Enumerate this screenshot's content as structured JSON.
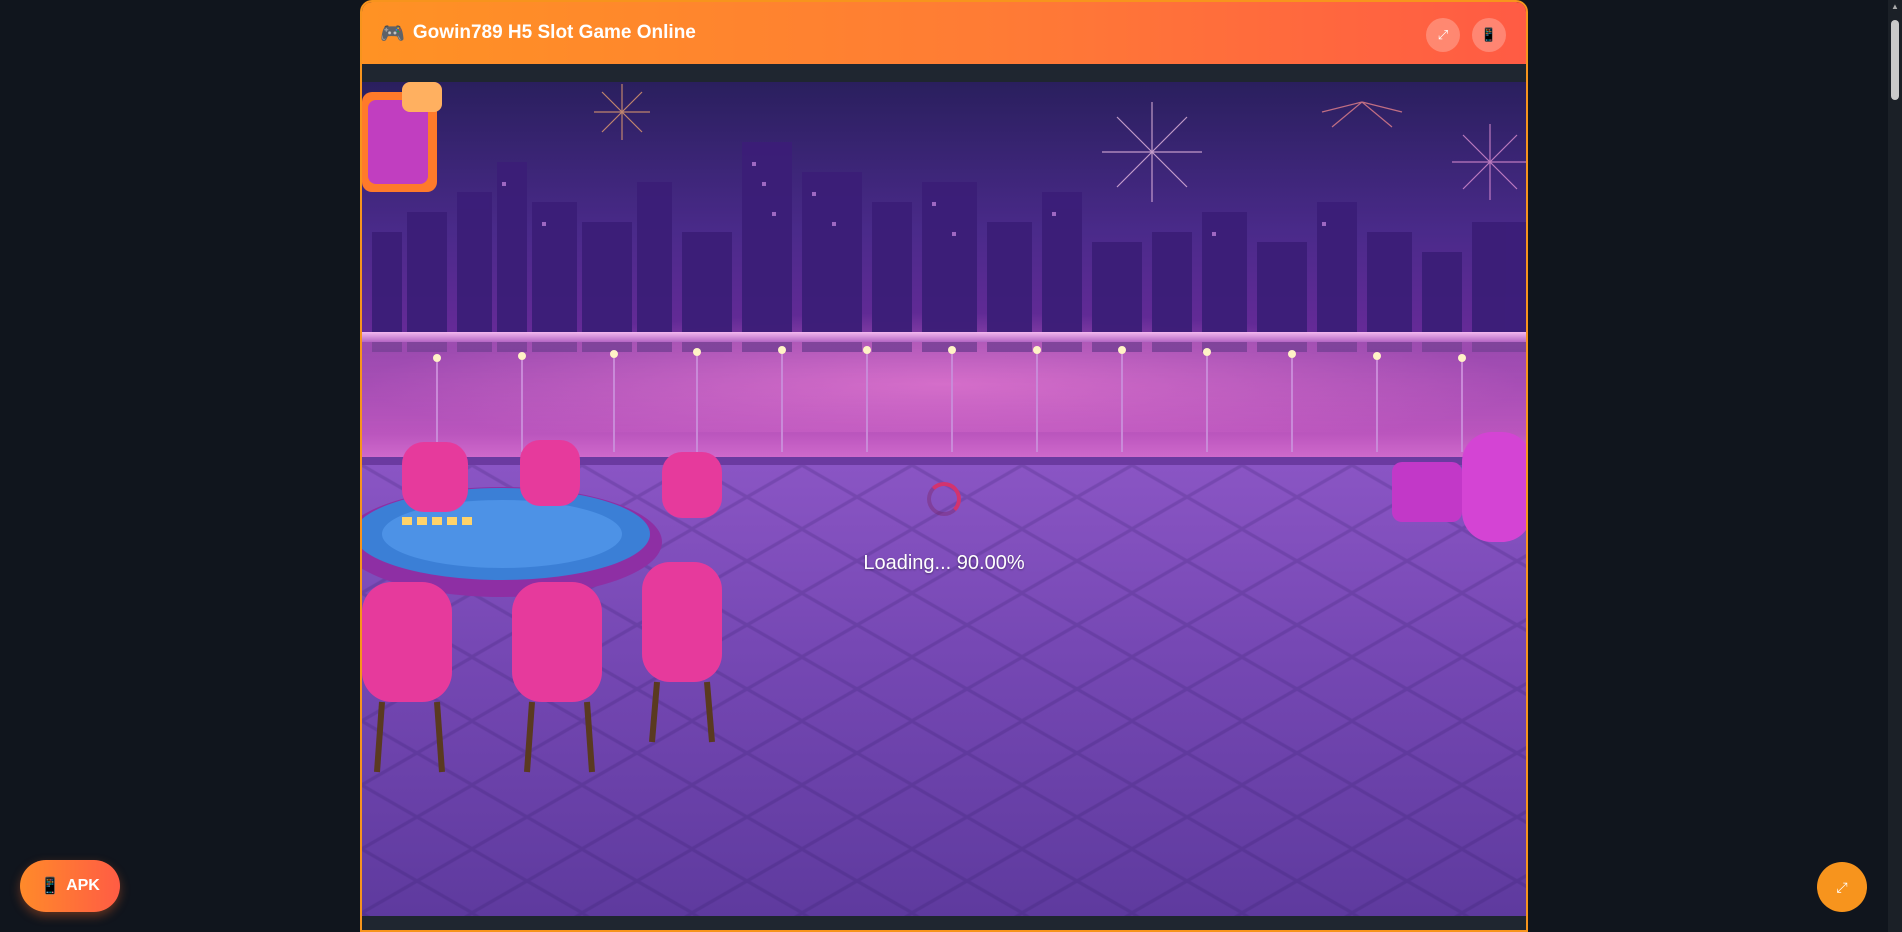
{
  "header": {
    "title": "Gowin789 H5 Slot Game Online",
    "title_icon": "🎮",
    "expand_icon": "⤢",
    "phone_icon": "📱"
  },
  "game": {
    "loading_text": "Loading... 90.00%",
    "progress_percent": 90.0
  },
  "apk_button": {
    "icon": "📱",
    "label": "APK"
  },
  "fab": {
    "icon": "⤢"
  },
  "colors": {
    "accent": "#f7941d",
    "header_start": "#ff9224",
    "header_end": "#ff5b44",
    "page_bg": "#10151d"
  }
}
